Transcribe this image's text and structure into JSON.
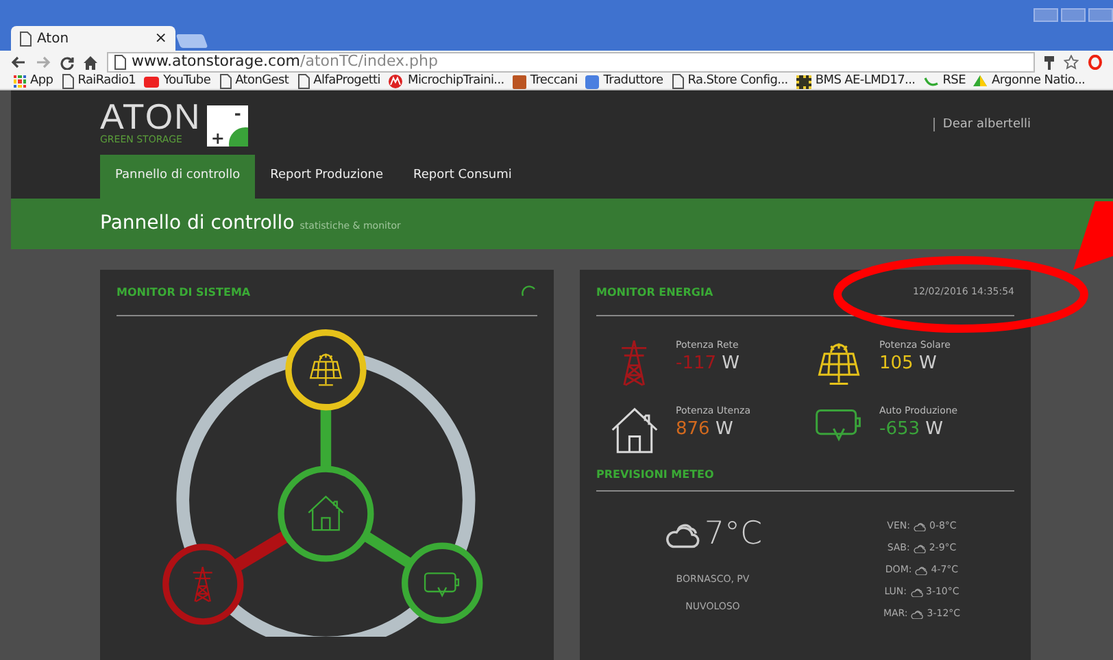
{
  "browser": {
    "tabs": [
      {
        "title": "Aton",
        "close": "×",
        "selected": true
      }
    ],
    "url_host": "www.atonstorage.com",
    "url_path": "/atonTC/index.php",
    "bookmarks": [
      {
        "label": "App",
        "kind": "apps"
      },
      {
        "label": "RaiRadio1",
        "kind": "page"
      },
      {
        "label": "YouTube",
        "kind": "youtube"
      },
      {
        "label": "AtonGest",
        "kind": "page"
      },
      {
        "label": "AlfaProgetti",
        "kind": "page"
      },
      {
        "label": "MicrochipTraini...",
        "kind": "microchip"
      },
      {
        "label": "Treccani",
        "kind": "treccani"
      },
      {
        "label": "Traduttore",
        "kind": "translate"
      },
      {
        "label": "Ra.Store Config...",
        "kind": "page"
      },
      {
        "label": "BMS AE-LMD17...",
        "kind": "film"
      },
      {
        "label": "RSE",
        "kind": "rse"
      },
      {
        "label": "Argonne Natio...",
        "kind": "drive"
      }
    ]
  },
  "header": {
    "logo": "ATON",
    "logo_sub": "GREEN STORAGE",
    "logo_plus": "+",
    "logo_minus": "-",
    "user": "Dear albertelli"
  },
  "nav": [
    {
      "label": "Pannello di controllo",
      "selected": true
    },
    {
      "label": "Report Produzione",
      "selected": false
    },
    {
      "label": "Report Consumi",
      "selected": false
    }
  ],
  "page_title": {
    "title": "Pannello di controllo",
    "subtitle": "statistiche & monitor"
  },
  "system_monitor": {
    "title": "MONITOR DI SISTEMA"
  },
  "energy_monitor": {
    "title": "MONITOR ENERGIA",
    "timestamp": "12/02/2016 14:35:54",
    "items": [
      {
        "label": "Potenza Rete",
        "value": "-117",
        "unit": "W",
        "kind": "grid",
        "color": "#a3161a"
      },
      {
        "label": "Potenza Solare",
        "value": "105",
        "unit": "W",
        "kind": "solar",
        "color": "#e6c21a"
      },
      {
        "label": "Potenza Utenza",
        "value": "876",
        "unit": "W",
        "kind": "house",
        "color": "#d2691e"
      },
      {
        "label": "Auto Produzione",
        "value": "-653",
        "unit": "W",
        "kind": "battery",
        "color": "#3aa33a"
      }
    ]
  },
  "weather": {
    "title": "PREVISIONI METEO",
    "temperature": "7°C",
    "location": "BORNASCO, PV",
    "condition": "NUVOLOSO",
    "forecast": [
      {
        "day": "VEN:",
        "range": "0-8°C"
      },
      {
        "day": "SAB:",
        "range": "2-9°C"
      },
      {
        "day": "DOM:",
        "range": "4-7°C"
      },
      {
        "day": "LUN:",
        "range": "3-10°C"
      },
      {
        "day": "MAR:",
        "range": "3-12°C"
      }
    ]
  }
}
